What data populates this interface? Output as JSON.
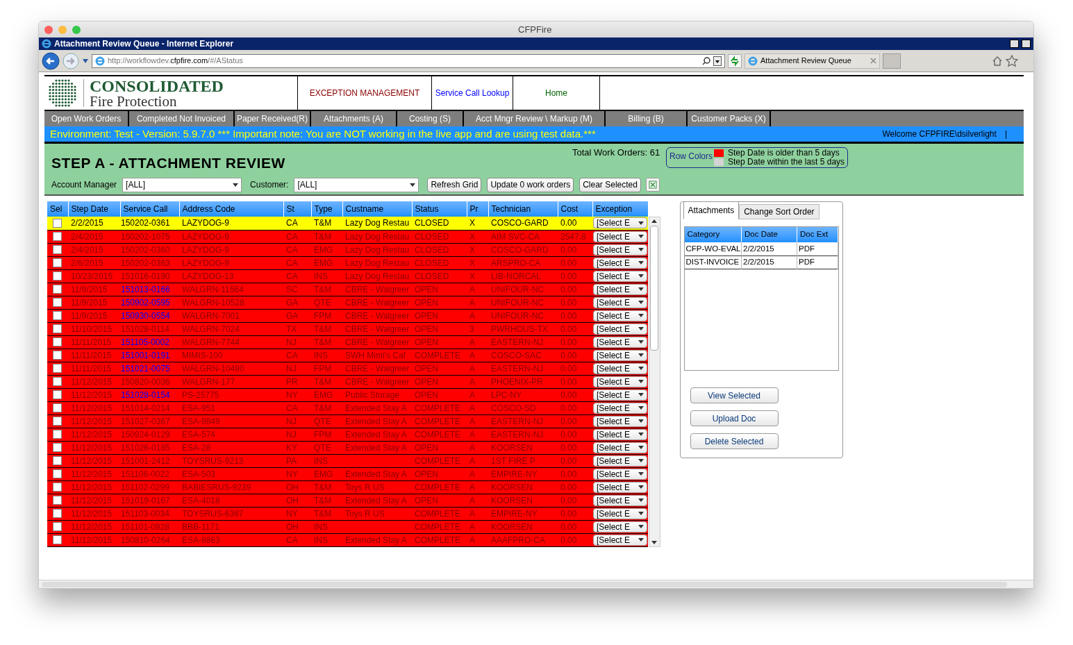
{
  "window": {
    "title": "CFPFire"
  },
  "browser": {
    "title": "Attachment Review Queue - Internet Explorer",
    "url_pre": "http://workflowdev.",
    "url_host": "cfpfire.com",
    "url_post": "/#/AStatus",
    "tab": "Attachment Review Queue"
  },
  "logo": {
    "line1": "CONSOLIDATED",
    "line2": "Fire Protection"
  },
  "top_nav": [
    {
      "label": "EXCEPTION MANAGEMENT",
      "color": "#8b0000"
    },
    {
      "label": "Service Call Lookup",
      "color": "#0000ff"
    },
    {
      "label": "Home",
      "color": "#006400"
    }
  ],
  "menu": [
    "Open Work Orders",
    "Completed Not Invoiced",
    "Paper Received(R)",
    "Attachments (A)",
    "Costing (S)",
    "Acct Mngr Review \\ Markup (M)",
    "Billing (B)",
    "Customer Packs (X)"
  ],
  "env_banner": {
    "text": "Environment: Test - Version: 5.9.7.0 *** Important note: You are NOT working in the live app and are using test data.***",
    "welcome": "Welcome CFPFIRE\\dsilverlight",
    "separator": "|"
  },
  "step": {
    "title": "STEP A - ATTACHMENT REVIEW",
    "total": "Total Work Orders: 61"
  },
  "legend": {
    "label": "Row Colors",
    "items": [
      {
        "color": "#ff0000",
        "text": "Step Date is older than 5 days"
      },
      {
        "color": "#d3d3d3",
        "text": "Step Date within the last 5 days"
      }
    ]
  },
  "filters": {
    "account_label": "Account Manager",
    "account_value": "[ALL]",
    "customer_label": "Customer:",
    "customer_value": "[ALL]"
  },
  "buttons": [
    "Refresh Grid",
    "Update 0 work orders",
    "Clear Selected"
  ],
  "table": {
    "columns": [
      "Sel",
      "Step Date",
      "Service Call",
      "Address Code",
      "St",
      "Type",
      "Custname",
      "Status",
      "Pr",
      "Technician",
      "Cost",
      "Exception"
    ],
    "rows": [
      {
        "selected": true,
        "linked": false,
        "cells": [
          "",
          "2/2/2015",
          "150202-0361",
          "LAZYDOG-9",
          "CA",
          "T&M",
          "Lazy Dog Restau",
          "CLOSED",
          "X",
          "COSCO-GARD",
          "0.00"
        ],
        "exception": "[Select E"
      },
      {
        "selected": false,
        "linked": false,
        "cells": [
          "",
          "2/4/2015",
          "150202-1075",
          "LAZYDOG-9",
          "CA",
          "T&M",
          "Lazy Dog Restau",
          "CLOSED",
          "X",
          "AIM SVC-CA",
          "2547.8"
        ],
        "exception": "[Select E"
      },
      {
        "selected": false,
        "linked": false,
        "cells": [
          "",
          "2/4/2015",
          "150202-0360",
          "LAZYDOG-9",
          "CA",
          "EMG",
          "Lazy Dog Restau",
          "CLOSED",
          "X",
          "COSCO-GARD",
          "0.00"
        ],
        "exception": "[Select E"
      },
      {
        "selected": false,
        "linked": false,
        "cells": [
          "",
          "2/6/2015",
          "150202-0363",
          "LAZYDOG-9",
          "CA",
          "EMG",
          "Lazy Dog Restau",
          "CLOSED",
          "X",
          "ARSPRO-CA",
          "0.00"
        ],
        "exception": "[Select E"
      },
      {
        "selected": false,
        "linked": false,
        "cells": [
          "",
          "10/23/2015",
          "151016-0190",
          "LAZYDOG-13",
          "CA",
          "INS",
          "Lazy Dog Restau",
          "CLOSED",
          "X",
          "LIB-NORCAL",
          "0.00"
        ],
        "exception": "[Select E"
      },
      {
        "selected": false,
        "linked": true,
        "cells": [
          "",
          "11/9/2015",
          "151013-0166",
          "WALGRN-11564",
          "SC",
          "T&M",
          "CBRE - Walgreer",
          "OPEN",
          "A",
          "UNIFOUR-NC",
          "0.00"
        ],
        "exception": "[Select E"
      },
      {
        "selected": false,
        "linked": true,
        "cells": [
          "",
          "11/9/2015",
          "150902-0595",
          "WALGRN-10528",
          "GA",
          "QTE",
          "CBRE - Walgreer",
          "OPEN",
          "A",
          "UNIFOUR-NC",
          "0.00"
        ],
        "exception": "[Select E"
      },
      {
        "selected": false,
        "linked": true,
        "cells": [
          "",
          "11/9/2015",
          "150930-0554",
          "WALGRN-7001",
          "GA",
          "FPM",
          "CBRE - Walgreer",
          "OPEN",
          "A",
          "UNIFOUR-NC",
          "0.00"
        ],
        "exception": "[Select E"
      },
      {
        "selected": false,
        "linked": false,
        "cells": [
          "",
          "11/10/2015",
          "151028-0114",
          "WALGRN-7024",
          "TX",
          "T&M",
          "CBRE - Walgreer",
          "OPEN",
          "3",
          "PWRHOUS-TX",
          "0.00"
        ],
        "exception": "[Select E"
      },
      {
        "selected": false,
        "linked": true,
        "cells": [
          "",
          "11/11/2015",
          "151105-0002",
          "WALGRN-7744",
          "NJ",
          "T&M",
          "CBRE - Walgreer",
          "OPEN",
          "A",
          "EASTERN-NJ",
          "0.00"
        ],
        "exception": "[Select E"
      },
      {
        "selected": false,
        "linked": true,
        "cells": [
          "",
          "11/11/2015",
          "151001-0191",
          "MIMIS-100",
          "CA",
          "INS",
          "SWH Mimi's Caf",
          "COMPLETE",
          "A",
          "COSCO-SAC",
          "0.00"
        ],
        "exception": "[Select E"
      },
      {
        "selected": false,
        "linked": true,
        "cells": [
          "",
          "11/11/2015",
          "151021-0075",
          "WALGRN-10490",
          "NJ",
          "FPM",
          "CBRE - Walgreer",
          "OPEN",
          "A",
          "EASTERN-NJ",
          "0.00"
        ],
        "exception": "[Select E"
      },
      {
        "selected": false,
        "linked": false,
        "cells": [
          "",
          "11/12/2015",
          "150820-0036",
          "WALGRN-177",
          "PR",
          "T&M",
          "CBRE - Walgreer",
          "OPEN",
          "A",
          "PHOENIX-PR",
          "0.00"
        ],
        "exception": "[Select E"
      },
      {
        "selected": false,
        "linked": true,
        "cells": [
          "",
          "11/12/2015",
          "151028-0154",
          "PS-25775",
          "NY",
          "EMG",
          "Public Storage",
          "OPEN",
          "A",
          "LPC-NY",
          "0.00"
        ],
        "exception": "[Select E"
      },
      {
        "selected": false,
        "linked": false,
        "cells": [
          "",
          "11/12/2015",
          "151014-0214",
          "ESA-951",
          "CA",
          "T&M",
          "Extended Stay A",
          "COMPLETE",
          "A",
          "COSCO-SD",
          "0.00"
        ],
        "exception": "[Select E"
      },
      {
        "selected": false,
        "linked": false,
        "cells": [
          "",
          "11/12/2015",
          "151027-0367",
          "ESA-9849",
          "NJ",
          "QTE",
          "Extended Stay A",
          "COMPLETE",
          "A",
          "EASTERN-NJ",
          "0.00"
        ],
        "exception": "[Select E"
      },
      {
        "selected": false,
        "linked": false,
        "cells": [
          "",
          "11/12/2015",
          "150924-0129",
          "ESA-574",
          "NJ",
          "FPM",
          "Extended Stay A",
          "COMPLETE",
          "A",
          "EASTERN-NJ",
          "0.00"
        ],
        "exception": "[Select E"
      },
      {
        "selected": false,
        "linked": false,
        "cells": [
          "",
          "11/12/2015",
          "151026-0185",
          "ESA-28",
          "KY",
          "QTE",
          "Extended Stay A",
          "OPEN",
          "A",
          "KOORSEN",
          "0.00"
        ],
        "exception": "[Select E"
      },
      {
        "selected": false,
        "linked": false,
        "cells": [
          "",
          "11/12/2015",
          "151001-2412",
          "TOYSRUS-9213",
          "PA",
          "INS",
          "",
          "COMPLETE",
          "A",
          "1ST FIRE P",
          "0.00"
        ],
        "exception": "[Select E"
      },
      {
        "selected": false,
        "linked": false,
        "cells": [
          "",
          "11/12/2015",
          "151106-0022",
          "ESA-503",
          "NY",
          "EMG",
          "Extended Stay A",
          "OPEN",
          "A",
          "EMPIRE-NY",
          "0.00"
        ],
        "exception": "[Select E"
      },
      {
        "selected": false,
        "linked": false,
        "cells": [
          "",
          "11/12/2015",
          "151102-0299",
          "BABIESRUS-9239",
          "OH",
          "T&M",
          "Toys R US",
          "COMPLETE",
          "A",
          "KOORSEN",
          "0.00"
        ],
        "exception": "[Select E"
      },
      {
        "selected": false,
        "linked": false,
        "cells": [
          "",
          "11/12/2015",
          "151019-0167",
          "ESA-4018",
          "OH",
          "T&M",
          "Extended Stay A",
          "OPEN",
          "A",
          "KOORSEN",
          "0.00"
        ],
        "exception": "[Select E"
      },
      {
        "selected": false,
        "linked": false,
        "cells": [
          "",
          "11/12/2015",
          "151103-0034",
          "TOYSRUS-6367",
          "NY",
          "T&M",
          "Toys R US",
          "COMPLETE",
          "A",
          "EMPIRE-NY",
          "0.00"
        ],
        "exception": "[Select E"
      },
      {
        "selected": false,
        "linked": false,
        "cells": [
          "",
          "11/12/2015",
          "151101-0928",
          "BBB-1171",
          "OH",
          "INS",
          "",
          "COMPLETE",
          "A",
          "KOORSEN",
          "0.00"
        ],
        "exception": "[Select E"
      },
      {
        "selected": false,
        "linked": false,
        "cells": [
          "",
          "11/12/2015",
          "150810-0264",
          "ESA-8863",
          "CA",
          "INS",
          "Extended Stay A",
          "COMPLETE",
          "A",
          "AAAFPRO-CA",
          "0.00"
        ],
        "exception": "[Select E"
      }
    ]
  },
  "attachments": {
    "tabs": [
      {
        "label": "Attachments",
        "selected": true
      },
      {
        "label": "Change Sort Order",
        "selected": false
      }
    ],
    "columns": [
      "Category",
      "Doc Date",
      "Doc Ext"
    ],
    "rows": [
      [
        "CFP-WO-EVAL",
        "2/2/2015",
        "PDF"
      ],
      [
        "DIST-INVOICE",
        "2/2/2015",
        "PDF"
      ]
    ],
    "buttons": [
      "View Selected",
      "Upload Doc",
      "Delete Selected"
    ]
  }
}
